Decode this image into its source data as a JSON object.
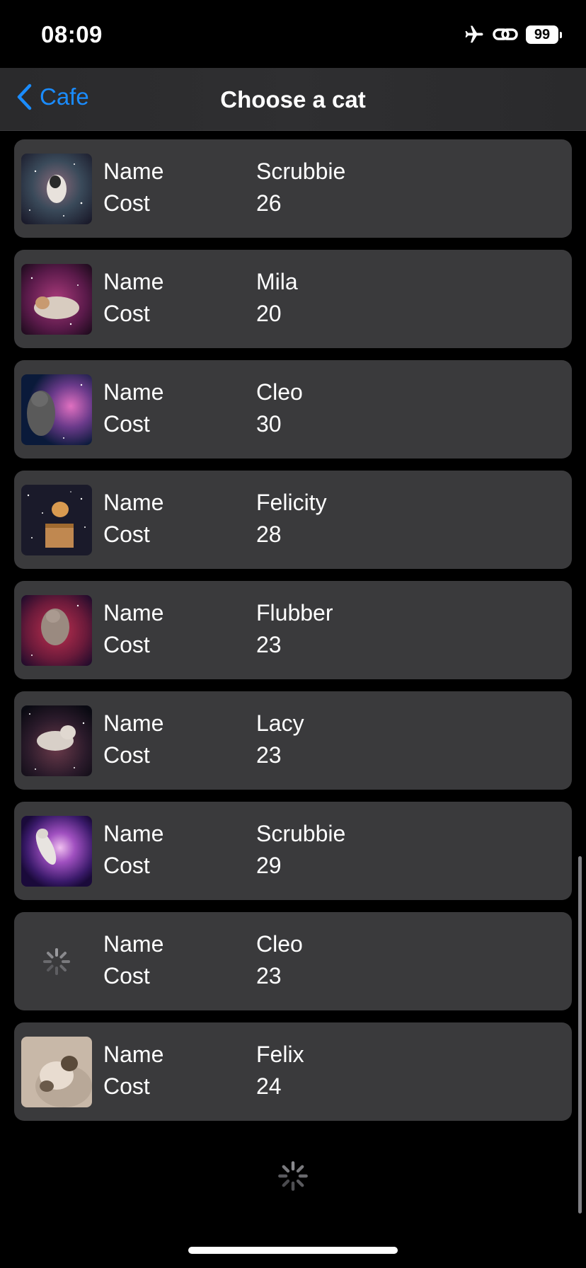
{
  "status_bar": {
    "time": "08:09",
    "battery": "99",
    "icons": [
      "airplane-icon",
      "link-icon",
      "battery-icon"
    ]
  },
  "nav": {
    "back_label": "Cafe",
    "title": "Choose a cat",
    "accent_color": "#1a8cff"
  },
  "labels": {
    "name": "Name",
    "cost": "Cost"
  },
  "cats": [
    {
      "name": "Scrubbie",
      "cost": "26",
      "image": "cat-in-space"
    },
    {
      "name": "Mila",
      "cost": "20",
      "image": "cat-in-space"
    },
    {
      "name": "Cleo",
      "cost": "30",
      "image": "cat-in-nebula"
    },
    {
      "name": "Felicity",
      "cost": "28",
      "image": "cat-in-box-space"
    },
    {
      "name": "Flubber",
      "cost": "23",
      "image": "cat-in-red-nebula"
    },
    {
      "name": "Lacy",
      "cost": "23",
      "image": "cat-in-space"
    },
    {
      "name": "Scrubbie",
      "cost": "29",
      "image": "cat-in-galaxy"
    },
    {
      "name": "Cleo",
      "cost": "23",
      "image": "loading-spinner"
    },
    {
      "name": "Felix",
      "cost": "24",
      "image": "cat-photo"
    }
  ],
  "colors": {
    "background": "#000000",
    "card": "#3a3a3c",
    "text": "#ffffff"
  }
}
